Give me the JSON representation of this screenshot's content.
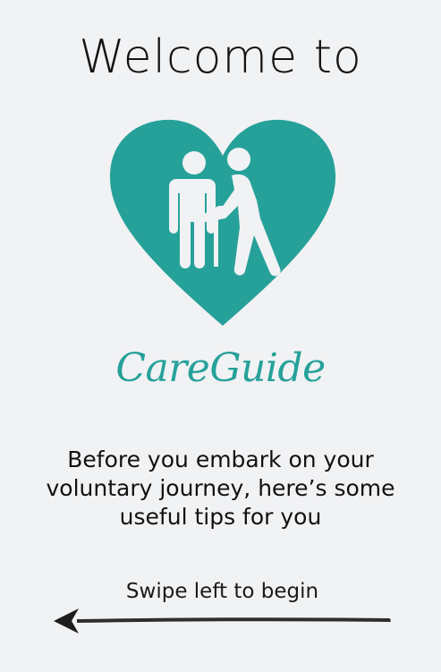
{
  "welcome": {
    "title": "Welcome to"
  },
  "logo": {
    "icon": "heart-caregiver-icon",
    "color": "#26a19a"
  },
  "brand": {
    "name": "CareGuide",
    "color": "#26a19a"
  },
  "intro": {
    "text": "Before you embark on your voluntary journey, here’s some useful tips for you"
  },
  "swipe": {
    "label": "Swipe left to begin",
    "icon": "arrow-left-icon"
  }
}
